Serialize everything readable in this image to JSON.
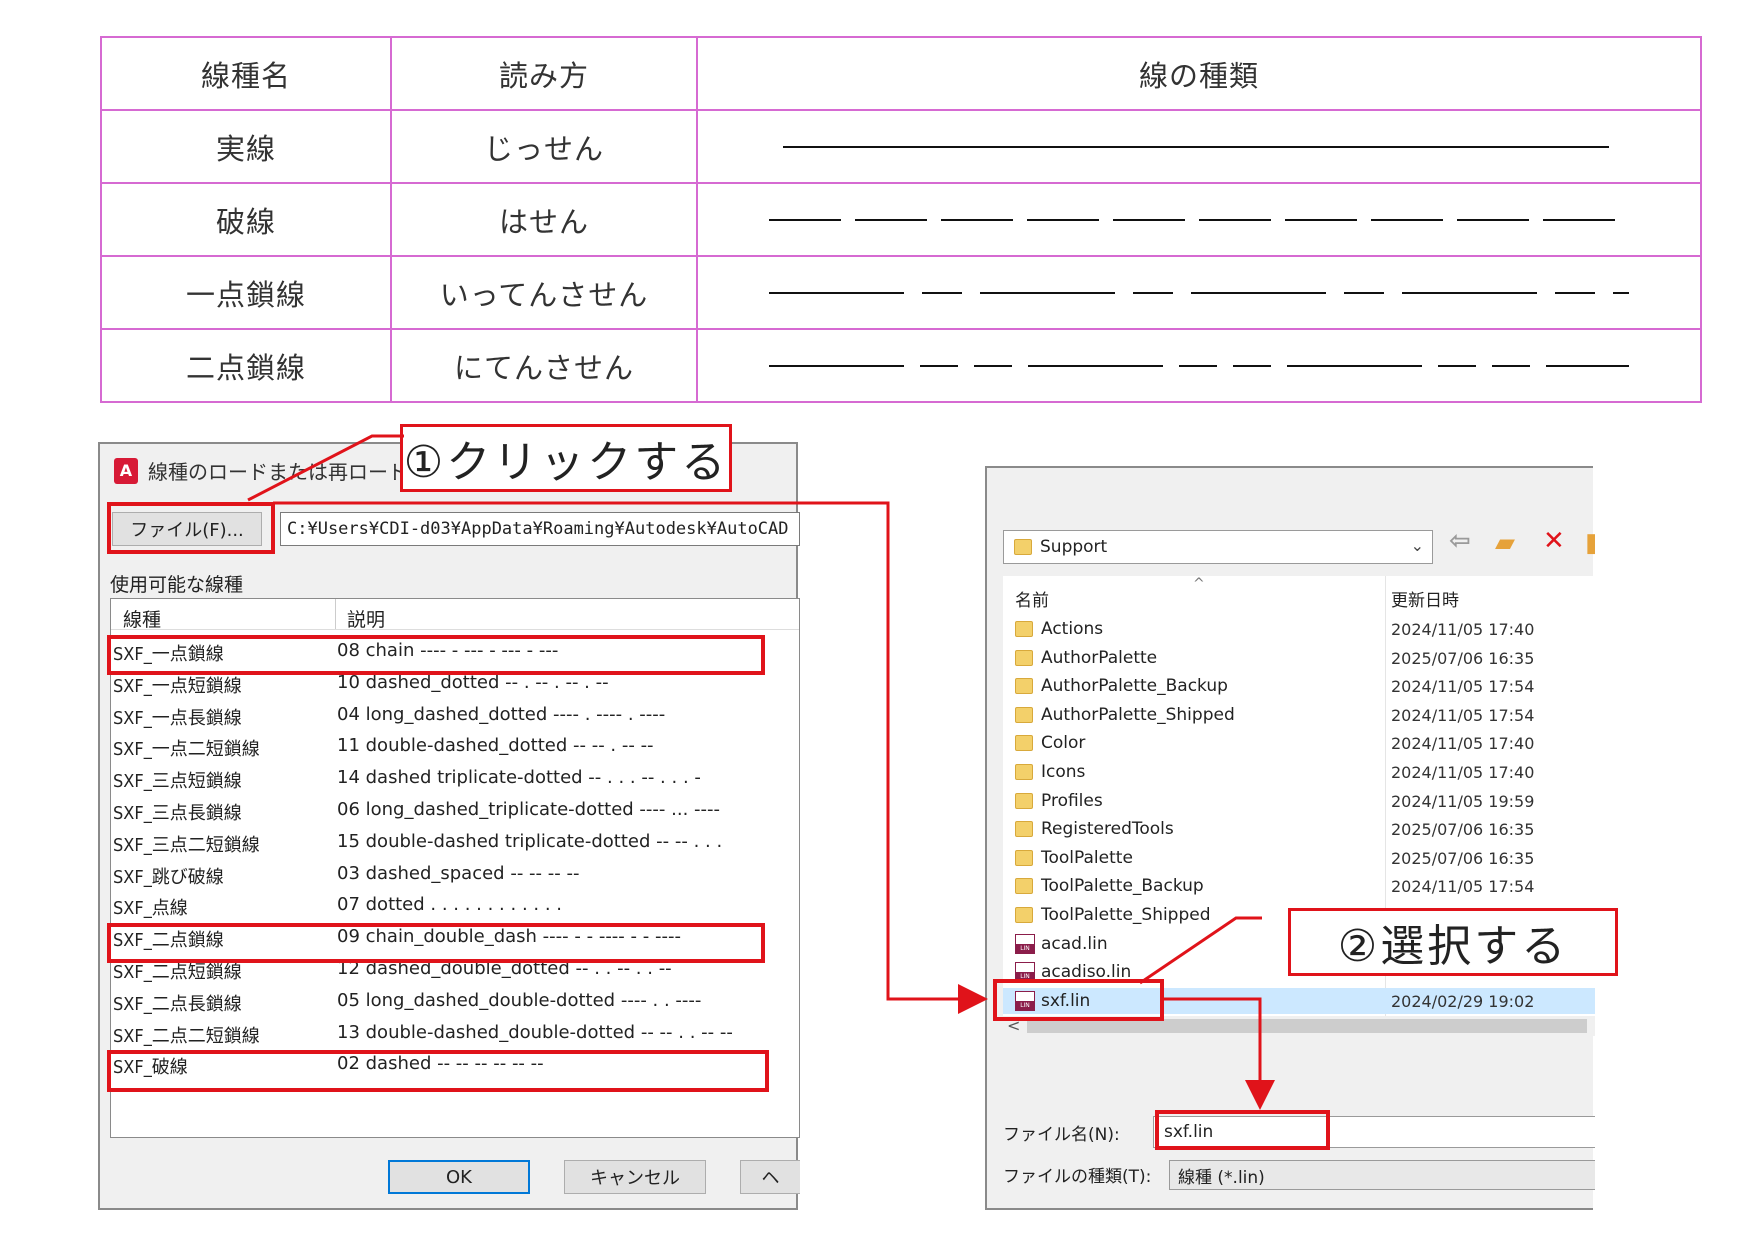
{
  "linetype_table": {
    "headers": [
      "線種名",
      "読み方",
      "線の種類"
    ],
    "rows": [
      {
        "name": "実線",
        "reading": "じっせん",
        "pattern": "solid"
      },
      {
        "name": "破線",
        "reading": "はせん",
        "pattern": "dashed"
      },
      {
        "name": "一点鎖線",
        "reading": "いってんさせん",
        "pattern": "chain"
      },
      {
        "name": "二点鎖線",
        "reading": "にてんさせん",
        "pattern": "double-chain"
      }
    ],
    "border_color": "#d66ad2"
  },
  "load_dialog": {
    "title": "線種のロードまたは再ロード",
    "app_icon": "A",
    "file_button": "ファイル(F)...",
    "path": "C:¥Users¥CDI-d03¥AppData¥Roaming¥Autodesk¥AutoCAD",
    "available_label": "使用可能な線種",
    "col_linetype": "線種",
    "col_description": "説明",
    "rows": [
      {
        "name": "SXF_一点鎖線",
        "desc": "08 chain ---- - --- - --- - ---"
      },
      {
        "name": "SXF_一点短鎖線",
        "desc": "10 dashed_dotted -- . -- . -- . --"
      },
      {
        "name": "SXF_一点長鎖線",
        "desc": "04 long_dashed_dotted ---- . ---- . ----"
      },
      {
        "name": "SXF_一点二短鎖線",
        "desc": "11 double-dashed_dotted -- -- . -- --"
      },
      {
        "name": "SXF_三点短鎖線",
        "desc": "14 dashed triplicate-dotted -- . . . -- . . . -"
      },
      {
        "name": "SXF_三点長鎖線",
        "desc": "06 long_dashed_triplicate-dotted ---- ... ----"
      },
      {
        "name": "SXF_三点二短鎖線",
        "desc": "15 double-dashed triplicate-dotted -- -- . . ."
      },
      {
        "name": "SXF_跳び破線",
        "desc": "03 dashed_spaced --  --  --  --"
      },
      {
        "name": "SXF_点線",
        "desc": "07 dotted . . . . . . . . . . . ."
      },
      {
        "name": "SXF_二点鎖線",
        "desc": "09 chain_double_dash ---- - - ---- - - ----"
      },
      {
        "name": "SXF_二点短鎖線",
        "desc": "12 dashed_double_dotted -- . . -- . . --"
      },
      {
        "name": "SXF_二点長鎖線",
        "desc": "05 long_dashed_double-dotted ---- . . ----"
      },
      {
        "name": "SXF_二点二短鎖線",
        "desc": "13 double-dashed_double-dotted -- -- . . -- --"
      },
      {
        "name": "SXF_破線",
        "desc": "02 dashed -- -- -- -- -- --"
      }
    ],
    "ok": "OK",
    "cancel": "キャンセル",
    "help": "ヘ"
  },
  "callouts": {
    "step1": "①クリックする",
    "step2": "②選択する",
    "color": "#e0131a"
  },
  "file_dialog": {
    "folder": "Support",
    "col_name": "名前",
    "col_date": "更新日時",
    "items": [
      {
        "name": "Actions",
        "date": "2024/11/05 17:40",
        "type": "folder"
      },
      {
        "name": "AuthorPalette",
        "date": "2025/07/06 16:35",
        "type": "folder"
      },
      {
        "name": "AuthorPalette_Backup",
        "date": "2024/11/05 17:54",
        "type": "folder"
      },
      {
        "name": "AuthorPalette_Shipped",
        "date": "2024/11/05 17:54",
        "type": "folder"
      },
      {
        "name": "Color",
        "date": "2024/11/05 17:40",
        "type": "folder"
      },
      {
        "name": "Icons",
        "date": "2024/11/05 17:40",
        "type": "folder"
      },
      {
        "name": "Profiles",
        "date": "2024/11/05 19:59",
        "type": "folder"
      },
      {
        "name": "RegisteredTools",
        "date": "2025/07/06 16:35",
        "type": "folder"
      },
      {
        "name": "ToolPalette",
        "date": "2025/07/06 16:35",
        "type": "folder"
      },
      {
        "name": "ToolPalette_Backup",
        "date": "2024/11/05 17:54",
        "type": "folder"
      },
      {
        "name": "ToolPalette_Shipped",
        "date": "",
        "type": "folder"
      },
      {
        "name": "acad.lin",
        "date": "",
        "type": "lin"
      },
      {
        "name": "acadiso.lin",
        "date": "",
        "type": "lin"
      },
      {
        "name": "sxf.lin",
        "date": "2024/02/29 19:02",
        "type": "lin",
        "selected": true
      }
    ],
    "filename_label": "ファイル名(N):",
    "filename_value": "sxf.lin",
    "filetype_label": "ファイルの種類(T):",
    "filetype_value": "線種 (*.lin)",
    "scroll_left": "<"
  }
}
